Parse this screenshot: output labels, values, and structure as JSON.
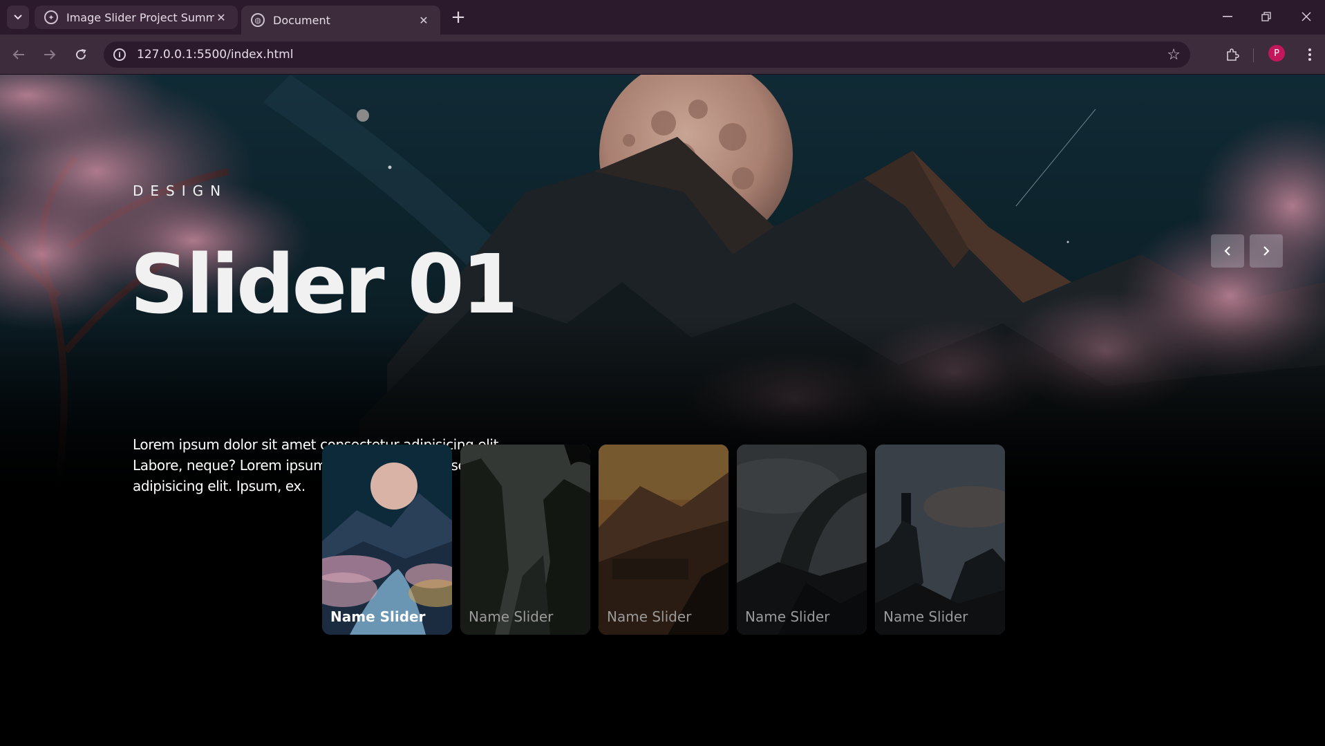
{
  "browser": {
    "tabs": [
      {
        "title": "Image Slider Project Summary",
        "active": false
      },
      {
        "title": "Document",
        "active": true
      }
    ],
    "url": "127.0.0.1:5500/index.html",
    "profile_initial": "P",
    "profile_color": "#c2185b"
  },
  "slider": {
    "current": {
      "author": "DESIGN",
      "title": "Slider 01",
      "description": "Lorem ipsum dolor sit amet consectetur adipisicing elit. Labore, neque? Lorem ipsum dolor sit amet consectetur adipisicing elit. Ipsum, ex."
    },
    "thumbnails": [
      {
        "label": "Name Slider",
        "active": true,
        "scene": "night-moon"
      },
      {
        "label": "Name Slider",
        "active": false,
        "scene": "cliffs"
      },
      {
        "label": "Name Slider",
        "active": false,
        "scene": "sunset-valley"
      },
      {
        "label": "Name Slider",
        "active": false,
        "scene": "stone-arch"
      },
      {
        "label": "Name Slider",
        "active": false,
        "scene": "statue-cliff"
      }
    ],
    "controls": {
      "prev_icon": "chevron-left-icon",
      "next_icon": "chevron-right-icon"
    }
  }
}
